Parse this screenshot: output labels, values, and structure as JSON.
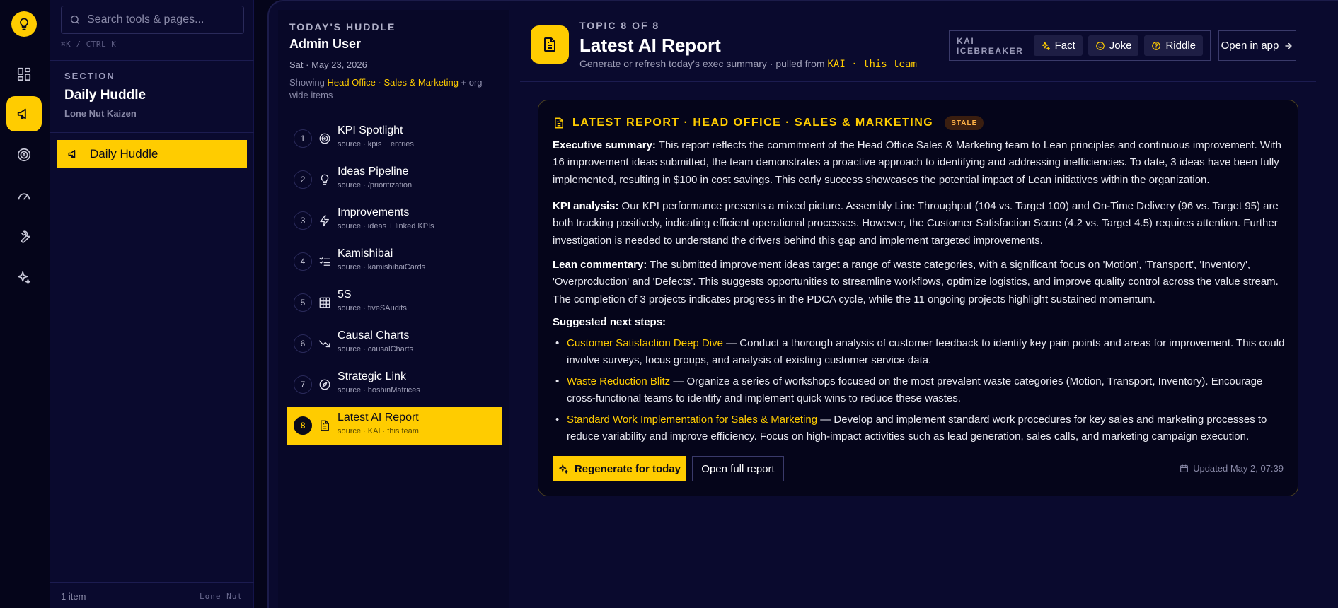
{
  "rail": {
    "logo_icon": "lightbulb-icon",
    "items": [
      {
        "icon": "dashboard-icon"
      },
      {
        "icon": "megaphone-icon",
        "active": true
      },
      {
        "icon": "target-icon"
      },
      {
        "icon": "gauge-icon"
      },
      {
        "icon": "wrench-icon"
      },
      {
        "icon": "sparkles-icon"
      }
    ]
  },
  "sidebar": {
    "search_placeholder": "Search tools & pages...",
    "search_hint": "⌘K / CTRL K",
    "section_label": "SECTION",
    "section_title": "Daily Huddle",
    "section_subtitle": "Lone Nut Kaizen",
    "nav_item_label": "Daily Huddle",
    "footer_count": "1 item",
    "footer_brand": "Lone Nut"
  },
  "agenda": {
    "eyebrow": "TODAY'S HUDDLE",
    "user": "Admin User",
    "date": "Sat · May 23, 2026",
    "showing_prefix": "Showing ",
    "showing_team": "Head Office · Sales & Marketing",
    "showing_suffix": " + org-wide items",
    "items": [
      {
        "num": "1",
        "name": "KPI Spotlight",
        "source": "source · kpis + entries",
        "icon": "target-icon"
      },
      {
        "num": "2",
        "name": "Ideas Pipeline",
        "source": "source · /prioritization",
        "icon": "lightbulb-icon"
      },
      {
        "num": "3",
        "name": "Improvements",
        "source": "source · ideas + linked KPIs",
        "icon": "lightning-icon"
      },
      {
        "num": "4",
        "name": "Kamishibai",
        "source": "source · kamishibaiCards",
        "icon": "checklist-icon"
      },
      {
        "num": "5",
        "name": "5S",
        "source": "source · fiveSAudits",
        "icon": "grid-icon"
      },
      {
        "num": "6",
        "name": "Causal Charts",
        "source": "source · causalCharts",
        "icon": "trend-down-icon"
      },
      {
        "num": "7",
        "name": "Strategic Link",
        "source": "source · hoshinMatrices",
        "icon": "compass-icon"
      },
      {
        "num": "8",
        "name": "Latest AI Report",
        "source": "source · KAI · this team",
        "icon": "document-icon",
        "active": true
      }
    ]
  },
  "header": {
    "eyebrow": "TOPIC 8 OF 8",
    "title": "Latest AI Report",
    "subtitle": "Generate or refresh today's exec summary · pulled from ",
    "subtitle_source": "KAI · this team",
    "icebreaker_label": "KAI ICEBREAKER",
    "chip_fact": "Fact",
    "chip_joke": "Joke",
    "chip_riddle": "Riddle",
    "open_app": "Open in app"
  },
  "report": {
    "title": "LATEST REPORT · HEAD OFFICE · SALES & MARKETING",
    "badge": "STALE",
    "exec_label": "Executive summary:",
    "exec_text": " This report reflects the commitment of the Head Office Sales & Marketing team to Lean principles and continuous improvement. With 16 improvement ideas submitted, the team demonstrates a proactive approach to identifying and addressing inefficiencies. To date, 3 ideas have been fully implemented, resulting in $100 in cost savings. This early success showcases the potential impact of Lean initiatives within the organization.",
    "kpi_label": "KPI analysis:",
    "kpi_text": " Our KPI performance presents a mixed picture. Assembly Line Throughput (104 vs. Target 100) and On-Time Delivery (96 vs. Target 95) are both tracking positively, indicating efficient operational processes. However, the Customer Satisfaction Score (4.2 vs. Target 4.5) requires attention. Further investigation is needed to understand the drivers behind this gap and implement targeted improvements.",
    "lean_label": "Lean commentary:",
    "lean_text": " The submitted improvement ideas target a range of waste categories, with a significant focus on 'Motion', 'Transport', 'Inventory', 'Overproduction' and 'Defects'. This suggests opportunities to streamline workflows, optimize logistics, and improve quality control across the value stream. The completion of 3 projects indicates progress in the PDCA cycle, while the 11 ongoing projects highlight sustained momentum.",
    "steps_title": "Suggested next steps:",
    "steps": [
      {
        "title": "Customer Satisfaction Deep Dive",
        "text": " — Conduct a thorough analysis of customer feedback to identify key pain points and areas for improvement. This could involve surveys, focus groups, and analysis of existing customer service data."
      },
      {
        "title": "Waste Reduction Blitz",
        "text": " — Organize a series of workshops focused on the most prevalent waste categories (Motion, Transport, Inventory). Encourage cross-functional teams to identify and implement quick wins to reduce these wastes."
      },
      {
        "title": "Standard Work Implementation for Sales & Marketing",
        "text": " — Develop and implement standard work procedures for key sales and marketing processes to reduce variability and improve efficiency. Focus on high-impact activities such as lead generation, sales calls, and marketing campaign execution."
      }
    ],
    "regenerate_label": "Regenerate for today",
    "open_full_label": "Open full report",
    "updated": "Updated May 2, 07:39"
  },
  "colors": {
    "accent": "#ffcc00",
    "background": "#05051a",
    "panel": "#0a0a2e",
    "stale_badge": "#ffb347"
  }
}
